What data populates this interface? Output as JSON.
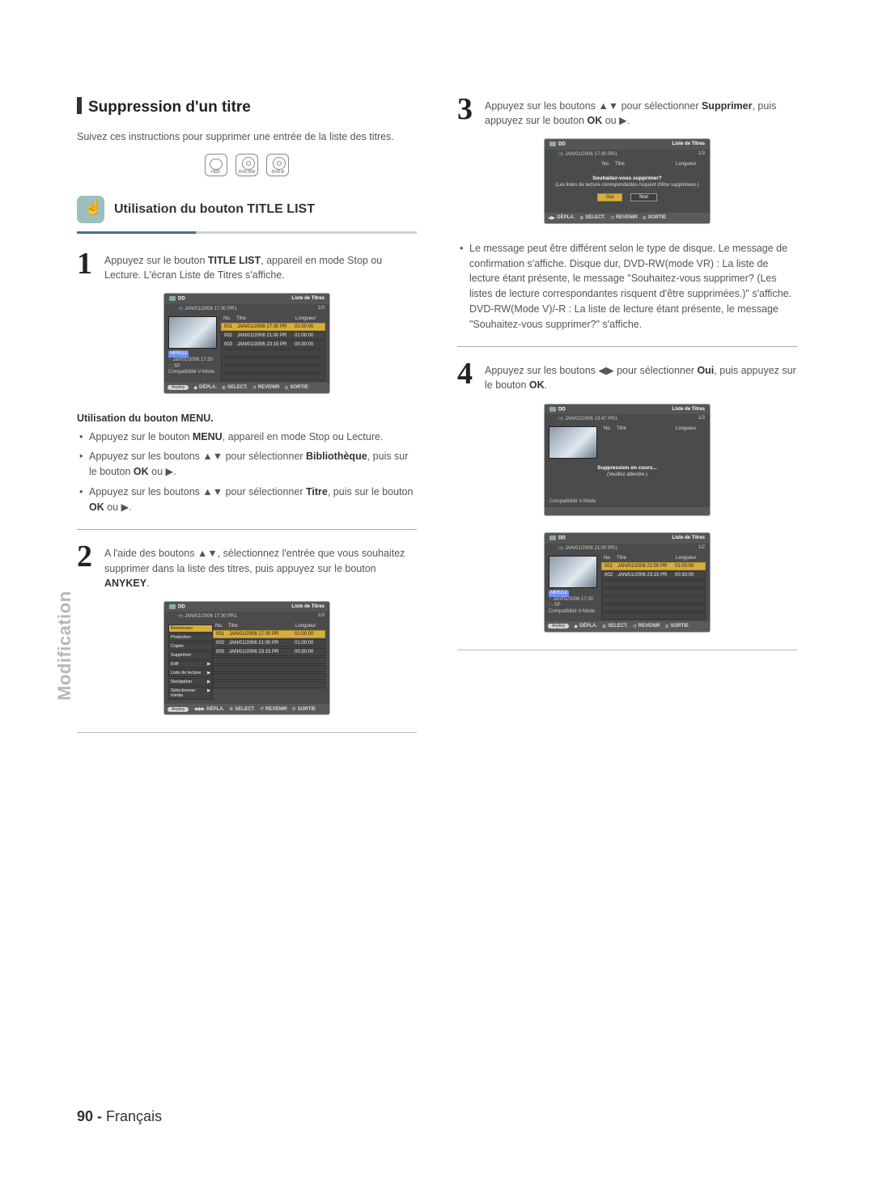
{
  "side_tab": "Modification",
  "footer": {
    "page": "90 -",
    "lang": "Français"
  },
  "left": {
    "title": "Suppression d'un titre",
    "intro": "Suivez ces instructions pour supprimer une entrée de la liste des titres.",
    "media": {
      "hdd": "HDD",
      "dvdrw": "DVD-RW",
      "dvdr": "DVD-R"
    },
    "subhead": "Utilisation du bouton TITLE LIST",
    "step1": {
      "num": "1",
      "l1a": "Appuyez sur le bouton ",
      "l1b": "TITLE LIST",
      "l1c": ", appareil en mode Stop ou Lecture. L'écran Liste de Titres s'affiche."
    },
    "screen1": {
      "hdd": "DD",
      "listtitle": "Liste de Titres",
      "date": "JAN/01/2006 17:30 PR1",
      "page": "1/3",
      "h_no": "No.",
      "h_title": "Titre",
      "h_len": "Longueur",
      "rows": [
        {
          "no": "001",
          "t": "JAN/01/2006 17:30 PR",
          "len": "01:00:00"
        },
        {
          "no": "002",
          "t": "JAN/01/2006 21:00 PR",
          "len": "01:00:00"
        },
        {
          "no": "003",
          "t": "JAN/01/2006 23:15 PR",
          "len": "00:30:00"
        }
      ],
      "mpeg": "MPEG2",
      "m1": "Jan/01/2006 17:30",
      "m2": "SP",
      "m3": "Compatibilité V-Mode",
      "anykey": "Anykey",
      "navs": {
        "depla": "DÉPLA.",
        "select": "SELECT.",
        "revenir": "REVENIR",
        "sortie": "SORTIE"
      }
    },
    "menu_head": "Utilisation du bouton MENU.",
    "menu_b1a": "Appuyez sur le bouton ",
    "menu_b1b": "MENU",
    "menu_b1c": ", appareil en mode Stop ou Lecture.",
    "menu_b2a": "Appuyez sur les boutons ",
    "menu_b2b": " pour sélectionner ",
    "menu_b2c": "Bibliothèque",
    "menu_b2d": ", puis sur le bouton ",
    "menu_b2e": "OK",
    "menu_b2f": " ou ",
    "menu_b3a": "Appuyez sur les boutons ",
    "menu_b3b": " pour sélectionner ",
    "menu_b3c": "Titre",
    "menu_b3d": ", puis sur le bouton ",
    "menu_b3e": "OK",
    "menu_b3f": " ou ",
    "step2": {
      "num": "2",
      "l": "A l'aide des boutons ▲▼, sélectionnez l'entrée que vous souhaitez supprimer dans la liste des titres, puis appuyez sur le bouton ",
      "b": "ANYKEY",
      "end": "."
    },
    "screen2": {
      "menu": [
        {
          "t": "Renommer",
          "a": false
        },
        {
          "t": "Protection",
          "a": false
        },
        {
          "t": "Copier",
          "a": false
        },
        {
          "t": "Supprimer",
          "a": false
        },
        {
          "t": "Edit",
          "a": true
        },
        {
          "t": "Liste de lecture",
          "a": true
        },
        {
          "t": "Navigation",
          "a": true
        },
        {
          "t": "Sélectionner média",
          "a": true
        }
      ]
    }
  },
  "right": {
    "step3": {
      "num": "3",
      "a": "Appuyez sur les boutons ",
      "b": " pour sélectionner ",
      "c": "Supprimer",
      "d": ", puis appuyez sur le bouton ",
      "e": "OK",
      "f": " ou "
    },
    "screen3": {
      "dialog_t": "Souhaitez-vous supprimer?",
      "dialog_s": "(Les listes de lecture correspondantes risquent d'être supprimées.)",
      "yes": "Oui",
      "no": "Non"
    },
    "note1": "Le message peut être différent selon le type de disque. Le message de confirmation s'affiche. Disque dur, DVD-RW(mode VR) : La liste de lecture étant présente, le message \"Souhaitez-vous supprimer? (Les listes de lecture correspondantes risquent d'être supprimées.)\" s'affiche.",
    "note1b": "DVD-RW(Mode V)/-R : La liste de lecture étant présente, le message \"Souhaitez-vous supprimer?\" s'affiche.",
    "step4": {
      "num": "4",
      "a": "Appuyez sur les boutons ",
      "b": " pour sélectionner ",
      "c": "Oui",
      "d": ", puis appuyez sur le bouton ",
      "e": "OK",
      "f": "."
    },
    "screen4": {
      "date": "JAN/02/2006 13:47 PR1",
      "dialog_t": "Suppression en cours...",
      "dialog_s": "(Veuillez attendre.)"
    },
    "screen5": {
      "date": "JAN/01/2006 21:00 PR1",
      "page": "1/2",
      "rows": [
        {
          "no": "001",
          "t": "JAN/01/2006 21:00 PR",
          "len": "01:00:00"
        },
        {
          "no": "002",
          "t": "JAN/01/2006 23:15 PR",
          "len": "00:30:00"
        }
      ],
      "m1": "Jan/01/2006 17:30"
    }
  }
}
